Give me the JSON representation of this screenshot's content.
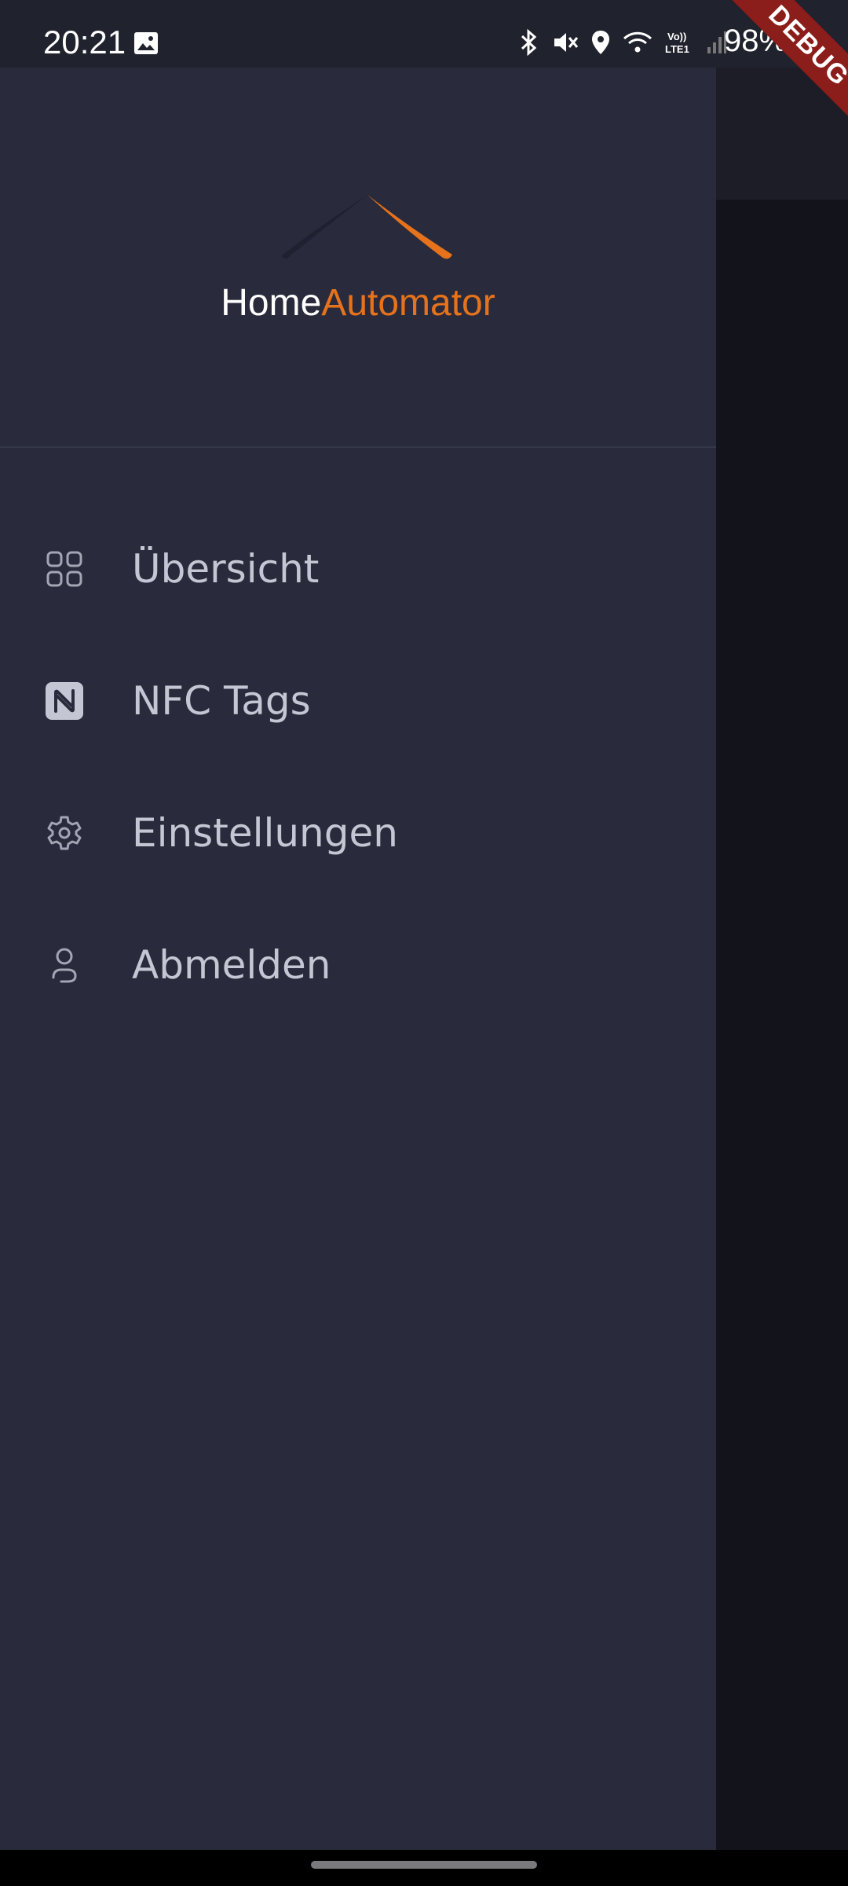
{
  "status_bar": {
    "time": "20:21",
    "battery": "98%",
    "icons": [
      "image-icon",
      "bluetooth-icon",
      "mute-icon",
      "location-icon",
      "wifi-icon",
      "volte-icon",
      "signal-icon",
      "battery-icon"
    ]
  },
  "brand": {
    "part1": "Home",
    "part2": "Automator",
    "accent_color": "#e6731c"
  },
  "menu": {
    "items": [
      {
        "label": "Übersicht",
        "icon": "dashboard-grid-icon"
      },
      {
        "label": "NFC Tags",
        "icon": "nfc-icon"
      },
      {
        "label": "Einstellungen",
        "icon": "gear-icon"
      },
      {
        "label": "Abmelden",
        "icon": "user-logout-icon"
      }
    ]
  },
  "debug_banner": "DEBUG",
  "colors": {
    "drawer_bg": "#292b3c",
    "label": "#c5c6d3",
    "accent": "#e6731c"
  }
}
